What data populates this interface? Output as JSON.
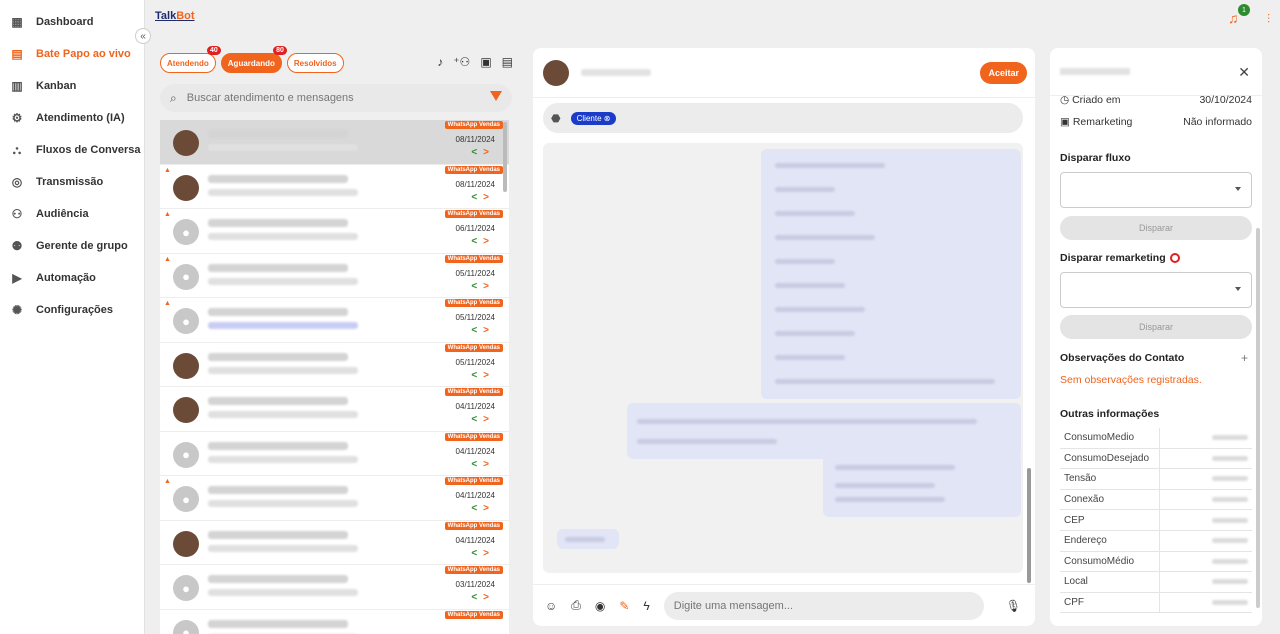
{
  "app": {
    "brand_prefix": "Talk",
    "brand_suffix": "Bot",
    "notifications": "1"
  },
  "sidebar": {
    "items": [
      {
        "label": "Dashboard",
        "icon": "dashboard-icon"
      },
      {
        "label": "Bate Papo ao vivo",
        "icon": "chat-icon"
      },
      {
        "label": "Kanban",
        "icon": "kanban-icon"
      },
      {
        "label": "Atendimento (IA)",
        "icon": "ai-icon"
      },
      {
        "label": "Fluxos de Conversa",
        "icon": "flow-icon"
      },
      {
        "label": "Transmissão",
        "icon": "broadcast-icon"
      },
      {
        "label": "Audiência",
        "icon": "audience-icon"
      },
      {
        "label": "Gerente de grupo",
        "icon": "group-icon"
      },
      {
        "label": "Automação",
        "icon": "play-icon"
      },
      {
        "label": "Configurações",
        "icon": "gear-icon"
      }
    ],
    "collapse": "«"
  },
  "tabs": [
    {
      "label": "Atendendo",
      "count": "40"
    },
    {
      "label": "Aguardando",
      "count": "80"
    },
    {
      "label": "Resolvidos",
      "count": ""
    }
  ],
  "search": {
    "placeholder": "Buscar atendimento e mensagens"
  },
  "conversations": [
    {
      "label": "WhatsApp Vendas",
      "date": "08/11/2024"
    },
    {
      "label": "WhatsApp Vendas",
      "date": "08/11/2024"
    },
    {
      "label": "WhatsApp Vendas",
      "date": "06/11/2024"
    },
    {
      "label": "WhatsApp Vendas",
      "date": "05/11/2024"
    },
    {
      "label": "WhatsApp Vendas",
      "date": "05/11/2024"
    },
    {
      "label": "WhatsApp Vendas",
      "date": "05/11/2024"
    },
    {
      "label": "WhatsApp Vendas",
      "date": "04/11/2024"
    },
    {
      "label": "WhatsApp Vendas",
      "date": "04/11/2024"
    },
    {
      "label": "WhatsApp Vendas",
      "date": "04/11/2024"
    },
    {
      "label": "WhatsApp Vendas",
      "date": "04/11/2024"
    },
    {
      "label": "WhatsApp Vendas",
      "date": "03/11/2024"
    },
    {
      "label": "WhatsApp Vendas",
      "date": ""
    }
  ],
  "chat": {
    "accept_label": "Aceitar",
    "tag": "Cliente",
    "input_placeholder": "Digite uma mensagem..."
  },
  "info": {
    "created_label": "Criado em",
    "created_value": "30/10/2024",
    "remarketing_label": "Remarketing",
    "remarketing_value": "Não informado",
    "flow_title": "Disparar fluxo",
    "fire_label": "Disparar",
    "remarketing_title": "Disparar remarketing",
    "obs_title": "Observações do Contato",
    "obs_empty": "Sem observações registradas.",
    "other_title": "Outras informações",
    "fields": [
      "ConsumoMedio",
      "ConsumoDesejado",
      "Tensão",
      "Conexão",
      "CEP",
      "Endereço",
      "ConsumoMédio",
      "Local",
      "CPF"
    ]
  },
  "colors": {
    "accent": "#f0641e",
    "brand": "#1b2b6b",
    "tag": "#1a3cc9"
  }
}
